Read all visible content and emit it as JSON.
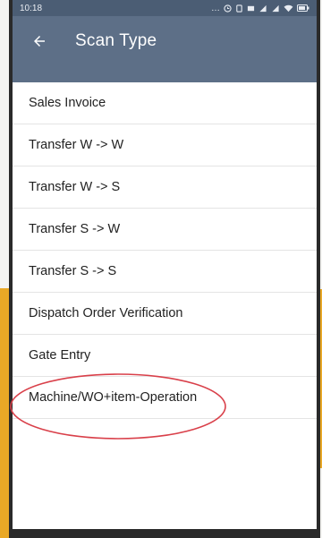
{
  "status_bar": {
    "time": "10:18",
    "icons": [
      "dots-icon",
      "alarm-icon",
      "vibrate-icon",
      "battery-saver-icon",
      "signal-icon",
      "signal-icon",
      "wifi-icon",
      "battery-icon"
    ]
  },
  "app_bar": {
    "title": "Scan Type",
    "back_icon": "arrow-left-icon"
  },
  "scan_types": [
    {
      "label": "Sales Invoice"
    },
    {
      "label": "Transfer W -> W"
    },
    {
      "label": "Transfer W -> S"
    },
    {
      "label": "Transfer S -> W"
    },
    {
      "label": "Transfer S -> S"
    },
    {
      "label": "Dispatch Order Verification"
    },
    {
      "label": "Gate Entry"
    },
    {
      "label": "Machine/WO+item-Operation"
    }
  ],
  "colors": {
    "app_bar": "#5d6f87",
    "status_bar": "#4b5d74",
    "highlight_circle": "#d9404a",
    "background_accent": "#e9a826"
  }
}
